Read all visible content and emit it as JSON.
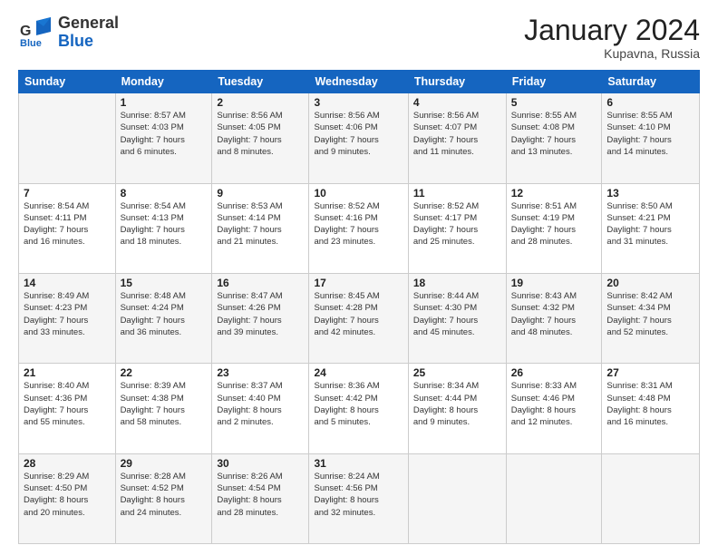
{
  "header": {
    "logo_general": "General",
    "logo_blue": "Blue",
    "month_title": "January 2024",
    "location": "Kupavna, Russia"
  },
  "weekdays": [
    "Sunday",
    "Monday",
    "Tuesday",
    "Wednesday",
    "Thursday",
    "Friday",
    "Saturday"
  ],
  "weeks": [
    [
      {
        "day": "",
        "info": ""
      },
      {
        "day": "1",
        "info": "Sunrise: 8:57 AM\nSunset: 4:03 PM\nDaylight: 7 hours\nand 6 minutes."
      },
      {
        "day": "2",
        "info": "Sunrise: 8:56 AM\nSunset: 4:05 PM\nDaylight: 7 hours\nand 8 minutes."
      },
      {
        "day": "3",
        "info": "Sunrise: 8:56 AM\nSunset: 4:06 PM\nDaylight: 7 hours\nand 9 minutes."
      },
      {
        "day": "4",
        "info": "Sunrise: 8:56 AM\nSunset: 4:07 PM\nDaylight: 7 hours\nand 11 minutes."
      },
      {
        "day": "5",
        "info": "Sunrise: 8:55 AM\nSunset: 4:08 PM\nDaylight: 7 hours\nand 13 minutes."
      },
      {
        "day": "6",
        "info": "Sunrise: 8:55 AM\nSunset: 4:10 PM\nDaylight: 7 hours\nand 14 minutes."
      }
    ],
    [
      {
        "day": "7",
        "info": "Sunrise: 8:54 AM\nSunset: 4:11 PM\nDaylight: 7 hours\nand 16 minutes."
      },
      {
        "day": "8",
        "info": "Sunrise: 8:54 AM\nSunset: 4:13 PM\nDaylight: 7 hours\nand 18 minutes."
      },
      {
        "day": "9",
        "info": "Sunrise: 8:53 AM\nSunset: 4:14 PM\nDaylight: 7 hours\nand 21 minutes."
      },
      {
        "day": "10",
        "info": "Sunrise: 8:52 AM\nSunset: 4:16 PM\nDaylight: 7 hours\nand 23 minutes."
      },
      {
        "day": "11",
        "info": "Sunrise: 8:52 AM\nSunset: 4:17 PM\nDaylight: 7 hours\nand 25 minutes."
      },
      {
        "day": "12",
        "info": "Sunrise: 8:51 AM\nSunset: 4:19 PM\nDaylight: 7 hours\nand 28 minutes."
      },
      {
        "day": "13",
        "info": "Sunrise: 8:50 AM\nSunset: 4:21 PM\nDaylight: 7 hours\nand 31 minutes."
      }
    ],
    [
      {
        "day": "14",
        "info": "Sunrise: 8:49 AM\nSunset: 4:23 PM\nDaylight: 7 hours\nand 33 minutes."
      },
      {
        "day": "15",
        "info": "Sunrise: 8:48 AM\nSunset: 4:24 PM\nDaylight: 7 hours\nand 36 minutes."
      },
      {
        "day": "16",
        "info": "Sunrise: 8:47 AM\nSunset: 4:26 PM\nDaylight: 7 hours\nand 39 minutes."
      },
      {
        "day": "17",
        "info": "Sunrise: 8:45 AM\nSunset: 4:28 PM\nDaylight: 7 hours\nand 42 minutes."
      },
      {
        "day": "18",
        "info": "Sunrise: 8:44 AM\nSunset: 4:30 PM\nDaylight: 7 hours\nand 45 minutes."
      },
      {
        "day": "19",
        "info": "Sunrise: 8:43 AM\nSunset: 4:32 PM\nDaylight: 7 hours\nand 48 minutes."
      },
      {
        "day": "20",
        "info": "Sunrise: 8:42 AM\nSunset: 4:34 PM\nDaylight: 7 hours\nand 52 minutes."
      }
    ],
    [
      {
        "day": "21",
        "info": "Sunrise: 8:40 AM\nSunset: 4:36 PM\nDaylight: 7 hours\nand 55 minutes."
      },
      {
        "day": "22",
        "info": "Sunrise: 8:39 AM\nSunset: 4:38 PM\nDaylight: 7 hours\nand 58 minutes."
      },
      {
        "day": "23",
        "info": "Sunrise: 8:37 AM\nSunset: 4:40 PM\nDaylight: 8 hours\nand 2 minutes."
      },
      {
        "day": "24",
        "info": "Sunrise: 8:36 AM\nSunset: 4:42 PM\nDaylight: 8 hours\nand 5 minutes."
      },
      {
        "day": "25",
        "info": "Sunrise: 8:34 AM\nSunset: 4:44 PM\nDaylight: 8 hours\nand 9 minutes."
      },
      {
        "day": "26",
        "info": "Sunrise: 8:33 AM\nSunset: 4:46 PM\nDaylight: 8 hours\nand 12 minutes."
      },
      {
        "day": "27",
        "info": "Sunrise: 8:31 AM\nSunset: 4:48 PM\nDaylight: 8 hours\nand 16 minutes."
      }
    ],
    [
      {
        "day": "28",
        "info": "Sunrise: 8:29 AM\nSunset: 4:50 PM\nDaylight: 8 hours\nand 20 minutes."
      },
      {
        "day": "29",
        "info": "Sunrise: 8:28 AM\nSunset: 4:52 PM\nDaylight: 8 hours\nand 24 minutes."
      },
      {
        "day": "30",
        "info": "Sunrise: 8:26 AM\nSunset: 4:54 PM\nDaylight: 8 hours\nand 28 minutes."
      },
      {
        "day": "31",
        "info": "Sunrise: 8:24 AM\nSunset: 4:56 PM\nDaylight: 8 hours\nand 32 minutes."
      },
      {
        "day": "",
        "info": ""
      },
      {
        "day": "",
        "info": ""
      },
      {
        "day": "",
        "info": ""
      }
    ]
  ]
}
